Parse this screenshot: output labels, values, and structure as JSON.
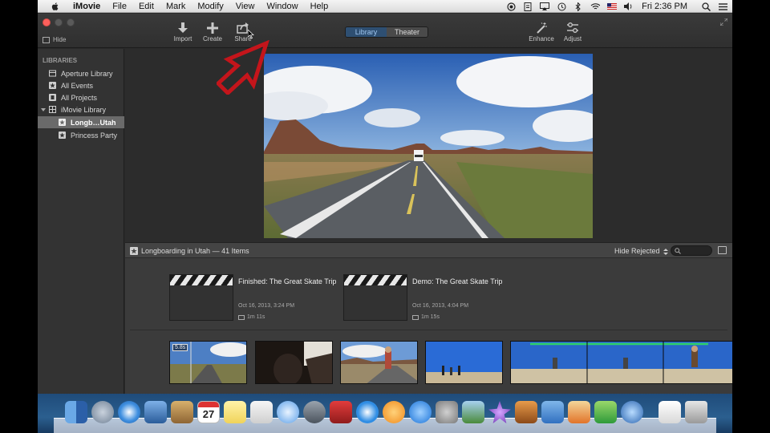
{
  "menubar": {
    "app_name": "iMovie",
    "items": [
      "File",
      "Edit",
      "Mark",
      "Modify",
      "View",
      "Window",
      "Help"
    ],
    "clock": "Fri 2:36 PM"
  },
  "toolbar": {
    "hide_label": "Hide",
    "import_label": "Import",
    "create_label": "Create",
    "share_label": "Share",
    "tabs": [
      "Library",
      "Theater"
    ],
    "active_tab": "Library",
    "enhance_label": "Enhance",
    "adjust_label": "Adjust"
  },
  "sidebar": {
    "header": "LIBRARIES",
    "items": [
      {
        "label": "Aperture Library",
        "icon": "aperture-icon"
      },
      {
        "label": "All Events",
        "icon": "star-icon"
      },
      {
        "label": "All Projects",
        "icon": "film-icon"
      },
      {
        "label": "iMovie Library",
        "icon": "grid-icon"
      },
      {
        "label": "Longb…Utah",
        "icon": "star-icon",
        "selected": true
      },
      {
        "label": "Princess Party",
        "icon": "star-icon"
      }
    ]
  },
  "browser": {
    "title": "Longboarding in Utah — 41 Items",
    "filter": "Hide Rejected",
    "projects": [
      {
        "title": "Finished: The Great Skate Trip",
        "date": "Oct 16, 2013, 3:24 PM",
        "length": "1m 11s"
      },
      {
        "title": "Demo: The Great Skate Trip",
        "date": "Oct 16, 2013, 4:04 PM",
        "length": "1m 15s"
      }
    ],
    "clip_badge": "5.8s"
  },
  "dock": {
    "calendar_day": "27"
  },
  "colors": {
    "menubar": "#e9e9e9",
    "toolbar": "#353535",
    "sidebar": "#333333",
    "selected_row": "#6a6a6a",
    "library_tab": "#2e4f72",
    "annotation_arrow": "#c4151b",
    "green_bar": "#2fd06a"
  }
}
